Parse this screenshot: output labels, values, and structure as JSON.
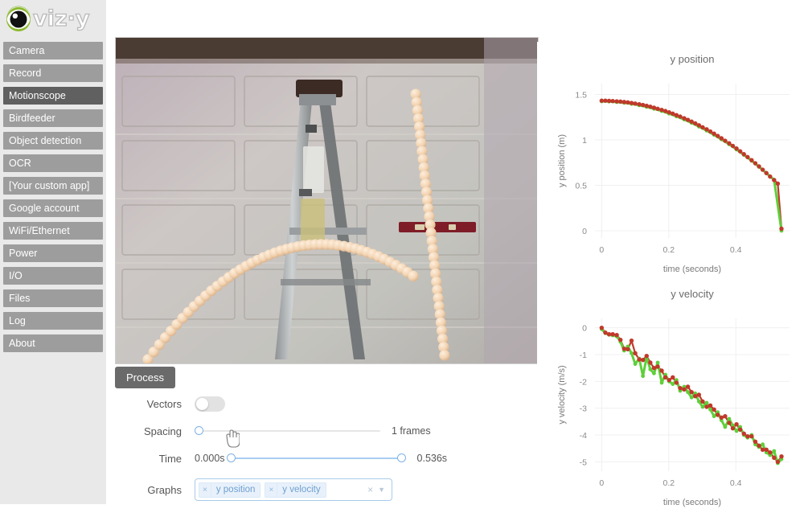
{
  "brand": {
    "name": "viz·y",
    "icon": "eye-icon"
  },
  "sidebar": {
    "items": [
      {
        "label": "Camera",
        "active": false
      },
      {
        "label": "Record",
        "active": false
      },
      {
        "label": "Motionscope",
        "active": true
      },
      {
        "label": "Birdfeeder",
        "active": false
      },
      {
        "label": "Object detection",
        "active": false
      },
      {
        "label": "OCR",
        "active": false
      },
      {
        "label": "[Your custom app]",
        "active": false
      },
      {
        "label": "Google account",
        "active": false
      },
      {
        "label": "WiFi/Ethernet",
        "active": false
      },
      {
        "label": "Power",
        "active": false
      },
      {
        "label": "I/O",
        "active": false
      },
      {
        "label": "Files",
        "active": false
      },
      {
        "label": "Log",
        "active": false
      },
      {
        "label": "About",
        "active": false
      }
    ]
  },
  "viewer": {
    "name": "motionscope-video-frame",
    "description": "Stroboscopic photo of a ball arcing over a stepladder in front of a garage door",
    "background_color": "#b3a9ad",
    "ball_color": "#f2d3b0"
  },
  "controls": {
    "process_label": "Process",
    "vectors": {
      "label": "Vectors",
      "value": false
    },
    "spacing": {
      "label": "Spacing",
      "value": 0,
      "value_text": "1 frames"
    },
    "time": {
      "label": "Time",
      "start_text": "0.000s",
      "end_text": "0.536s",
      "start": 0,
      "end": 100
    },
    "graphs": {
      "label": "Graphs",
      "tags": [
        "y position",
        "y velocity"
      ],
      "remove_icon": "close-icon",
      "clear_icon": "clear-icon",
      "dropdown_icon": "chevron-down-icon"
    }
  },
  "chart_data": [
    {
      "name": "y-position-chart",
      "type": "scatter",
      "title": "y position",
      "xlabel": "time (seconds)",
      "ylabel": "y position (m)",
      "xlim": [
        -0.02,
        0.56
      ],
      "ylim": [
        -0.08,
        1.62
      ],
      "xticks": [
        0,
        0.2,
        0.4
      ],
      "xticklabels": [
        "0",
        "0.2",
        "0.4"
      ],
      "yticks": [
        0,
        0.5,
        1,
        1.5
      ],
      "yticklabels": [
        "0",
        "0.5",
        "1",
        "1.5"
      ],
      "grid": true,
      "legend": "none",
      "series": [
        {
          "name": "measured",
          "color": "#c0392b",
          "marker": "circle",
          "x": [
            0.0,
            0.011,
            0.022,
            0.033,
            0.045,
            0.056,
            0.067,
            0.078,
            0.089,
            0.1,
            0.112,
            0.123,
            0.134,
            0.145,
            0.156,
            0.167,
            0.179,
            0.19,
            0.201,
            0.212,
            0.223,
            0.234,
            0.246,
            0.257,
            0.268,
            0.279,
            0.29,
            0.301,
            0.313,
            0.324,
            0.335,
            0.346,
            0.357,
            0.368,
            0.38,
            0.391,
            0.402,
            0.413,
            0.424,
            0.435,
            0.447,
            0.458,
            0.469,
            0.48,
            0.491,
            0.502,
            0.514,
            0.525,
            0.536
          ],
          "y": [
            1.432,
            1.432,
            1.43,
            1.428,
            1.425,
            1.422,
            1.418,
            1.413,
            1.407,
            1.4,
            1.393,
            1.385,
            1.376,
            1.366,
            1.355,
            1.343,
            1.331,
            1.318,
            1.304,
            1.289,
            1.273,
            1.257,
            1.239,
            1.221,
            1.202,
            1.182,
            1.161,
            1.139,
            1.117,
            1.093,
            1.069,
            1.044,
            1.018,
            0.991,
            0.963,
            0.934,
            0.905,
            0.874,
            0.843,
            0.811,
            0.777,
            0.743,
            0.708,
            0.672,
            0.635,
            0.597,
            0.558,
            0.519,
            0.022
          ]
        },
        {
          "name": "fit",
          "color": "#5fcf3a",
          "marker": "line",
          "x": [
            0.0,
            0.022,
            0.045,
            0.067,
            0.089,
            0.112,
            0.134,
            0.156,
            0.179,
            0.201,
            0.223,
            0.246,
            0.268,
            0.29,
            0.313,
            0.335,
            0.357,
            0.38,
            0.402,
            0.424,
            0.447,
            0.469,
            0.491,
            0.514,
            0.536
          ],
          "y": [
            1.425,
            1.423,
            1.417,
            1.409,
            1.397,
            1.382,
            1.364,
            1.343,
            1.318,
            1.29,
            1.259,
            1.225,
            1.188,
            1.147,
            1.103,
            1.056,
            1.006,
            0.952,
            0.895,
            0.835,
            0.771,
            0.704,
            0.634,
            0.561,
            0.0
          ]
        }
      ]
    },
    {
      "name": "y-velocity-chart",
      "type": "line",
      "title": "y velocity",
      "xlabel": "time (seconds)",
      "ylabel": "y velocity (m/s)",
      "xlim": [
        -0.02,
        0.56
      ],
      "ylim": [
        -5.35,
        0.35
      ],
      "xticks": [
        0,
        0.2,
        0.4
      ],
      "xticklabels": [
        "0",
        "0.2",
        "0.4"
      ],
      "yticks": [
        0,
        -1,
        -2,
        -3,
        -4,
        -5
      ],
      "yticklabels": [
        "0",
        "-1",
        "-2",
        "-3",
        "-4",
        "-5"
      ],
      "grid": true,
      "legend": "none",
      "series": [
        {
          "name": "measured",
          "color": "#c0392b",
          "marker": "circle",
          "x": [
            0.0,
            0.011,
            0.022,
            0.033,
            0.045,
            0.056,
            0.067,
            0.078,
            0.089,
            0.1,
            0.112,
            0.123,
            0.134,
            0.145,
            0.156,
            0.167,
            0.179,
            0.19,
            0.201,
            0.212,
            0.223,
            0.234,
            0.246,
            0.257,
            0.268,
            0.279,
            0.29,
            0.301,
            0.313,
            0.324,
            0.335,
            0.346,
            0.357,
            0.368,
            0.38,
            0.391,
            0.402,
            0.413,
            0.424,
            0.435,
            0.447,
            0.458,
            0.469,
            0.48,
            0.491,
            0.502,
            0.514,
            0.525,
            0.536
          ],
          "y": [
            0.0,
            -0.18,
            -0.24,
            -0.24,
            -0.27,
            -0.45,
            -0.78,
            -0.8,
            -0.48,
            -0.95,
            -1.18,
            -1.2,
            -1.05,
            -1.3,
            -1.5,
            -1.45,
            -1.6,
            -1.85,
            -1.95,
            -1.85,
            -2.05,
            -2.25,
            -2.3,
            -2.2,
            -2.4,
            -2.55,
            -2.5,
            -2.75,
            -2.95,
            -2.9,
            -3.05,
            -3.25,
            -3.35,
            -3.3,
            -3.55,
            -3.75,
            -3.6,
            -3.8,
            -3.95,
            -4.05,
            -4.05,
            -4.25,
            -4.4,
            -4.55,
            -4.55,
            -4.65,
            -4.85,
            -5.0,
            -4.8
          ]
        },
        {
          "name": "fit",
          "color": "#5fcf3a",
          "marker": "line",
          "x": [
            0.0,
            0.011,
            0.022,
            0.033,
            0.045,
            0.056,
            0.067,
            0.078,
            0.089,
            0.1,
            0.112,
            0.123,
            0.134,
            0.145,
            0.156,
            0.167,
            0.179,
            0.19,
            0.201,
            0.212,
            0.223,
            0.234,
            0.246,
            0.257,
            0.268,
            0.279,
            0.29,
            0.301,
            0.313,
            0.324,
            0.335,
            0.346,
            0.357,
            0.368,
            0.38,
            0.391,
            0.402,
            0.413,
            0.424,
            0.435,
            0.447,
            0.458,
            0.469,
            0.48,
            0.491,
            0.502,
            0.514,
            0.525,
            0.536
          ],
          "y": [
            -0.05,
            -0.2,
            -0.26,
            -0.28,
            -0.32,
            -0.52,
            -0.85,
            -0.7,
            -0.95,
            -1.35,
            -1.15,
            -1.8,
            -1.1,
            -1.55,
            -1.7,
            -1.3,
            -2.05,
            -1.75,
            -2.0,
            -2.1,
            -1.95,
            -2.35,
            -2.2,
            -2.4,
            -2.6,
            -2.45,
            -2.75,
            -2.95,
            -2.8,
            -3.05,
            -3.3,
            -3.15,
            -3.45,
            -3.7,
            -3.4,
            -3.65,
            -3.85,
            -3.7,
            -4.0,
            -4.1,
            -4.0,
            -4.35,
            -4.45,
            -4.35,
            -4.65,
            -4.75,
            -4.6,
            -5.05,
            -4.9
          ]
        }
      ]
    }
  ]
}
